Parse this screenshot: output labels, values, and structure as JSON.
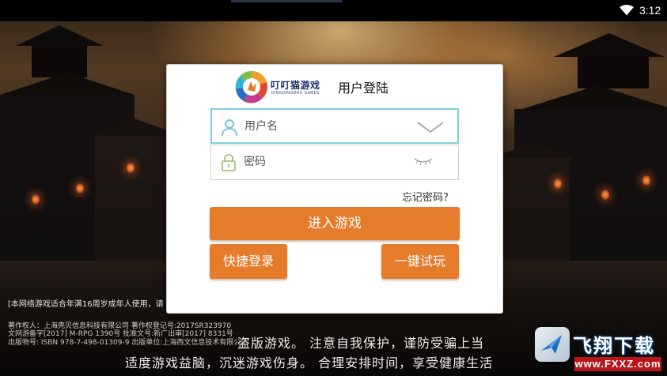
{
  "status_bar": {
    "time": "3:12",
    "wifi_icon": "wifi-icon"
  },
  "login_dialog": {
    "brand_name": "叮叮猫游戏",
    "brand_subtitle": "DINGDINGMAO GAMES",
    "title": "用户登陆",
    "username_placeholder": "用户名",
    "username_value": "",
    "password_placeholder": "密码",
    "password_value": "",
    "forgot_password": "忘记密码?",
    "enter_game_button": "进入游戏",
    "quick_login_button": "快捷登录",
    "one_click_trial_button": "一键试玩",
    "accent_color": "#e47c2c",
    "focus_border_color": "#7fd0de"
  },
  "background": {
    "age_notice": "[本网络游戏适合年满16周岁成年人使用，请",
    "copyright_line1": "著作权人：上海壳贝信息科技有限公司 著作权登记号:2017SR323970",
    "copyright_line2": "文网游备字[2017] M-RPG 1390号 批准文号:新广出审[2017] 8331号",
    "copyright_line3": "出版物号: ISBN 978-7-498-01309-9 出版单位:上海西文信息技术有限公司",
    "health_advice_line1": "盗版游戏。 注意自我保护，谨防受骗上当",
    "health_advice_line2": "适度游戏益脑，沉迷游戏伤身。 合理安排时间，享受健康生活"
  },
  "watermark": {
    "title": "飞翔下载",
    "url": "www.FXXZ.com"
  }
}
